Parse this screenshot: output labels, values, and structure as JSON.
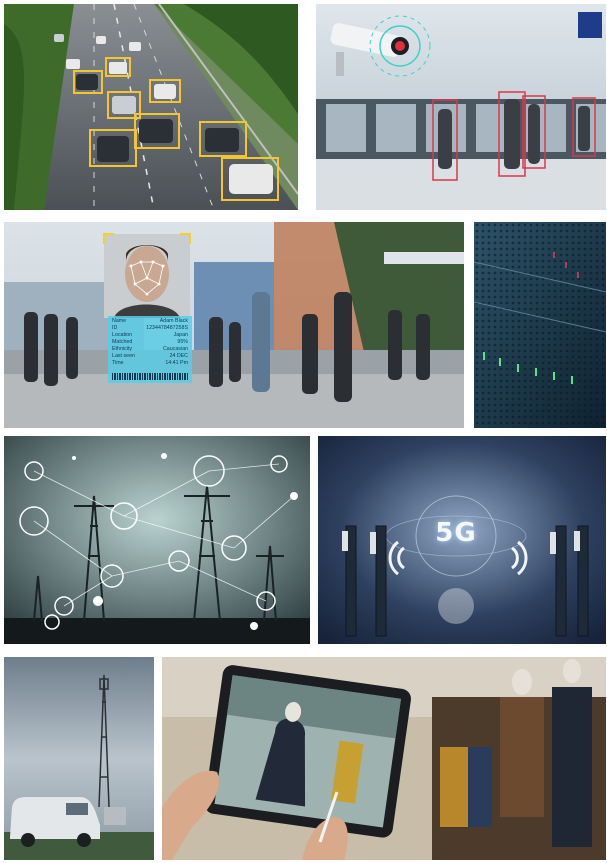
{
  "collage": {
    "description_free": true,
    "tiles": [
      {
        "id": "traffic",
        "kind": "photo"
      },
      {
        "id": "cctv",
        "kind": "photo"
      },
      {
        "id": "face",
        "kind": "photo"
      },
      {
        "id": "server",
        "kind": "photo"
      },
      {
        "id": "power",
        "kind": "photo"
      },
      {
        "id": "fiveg",
        "kind": "photo"
      },
      {
        "id": "tower",
        "kind": "photo"
      },
      {
        "id": "tablet",
        "kind": "photo"
      }
    ]
  },
  "face_card": {
    "rows": [
      {
        "label": "Name",
        "value": "Adam Black"
      },
      {
        "label": "ID",
        "value": "1234478487258S"
      },
      {
        "label": "Location",
        "value": "Japan"
      },
      {
        "label": "Matched",
        "value": "95%"
      },
      {
        "label": "Ethnicity",
        "value": "Caucasian"
      },
      {
        "label": "Last seen",
        "value": "24 DEC"
      },
      {
        "label": "Time",
        "value": "14:41 Pm"
      }
    ]
  },
  "fiveg": {
    "label": "5G"
  }
}
